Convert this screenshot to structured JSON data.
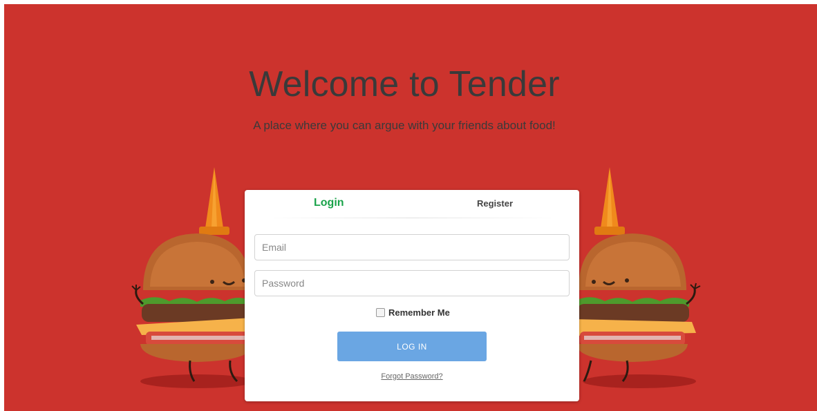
{
  "hero": {
    "title": "Welcome to Tender",
    "subtitle": "A place where you can argue with your friends about food!",
    "background_color": "#cc332d"
  },
  "login_card": {
    "tabs": [
      {
        "label": "Login",
        "active": true
      },
      {
        "label": "Register",
        "active": false
      }
    ],
    "email_field": {
      "value": "",
      "placeholder": "Email"
    },
    "password_field": {
      "value": "",
      "placeholder": "Password"
    },
    "remember_me": {
      "label": "Remember Me",
      "checked": false
    },
    "login_button_label": "LOG IN",
    "forgot_password_label": "Forgot Password?",
    "accent_color": "#1aa34a",
    "button_color": "#6aa6e3"
  },
  "decorations": [
    {
      "icon": "burger-mascot-with-cone-icon",
      "side": "left"
    },
    {
      "icon": "burger-mascot-with-cone-icon",
      "side": "right"
    }
  ]
}
